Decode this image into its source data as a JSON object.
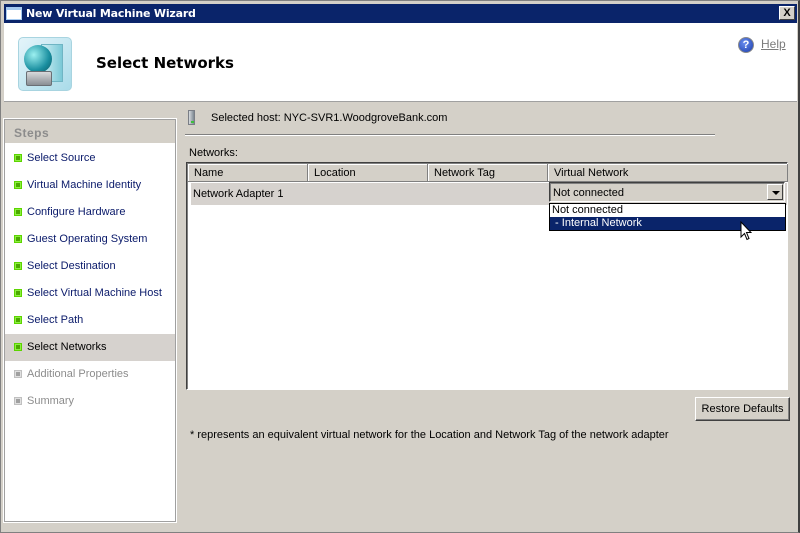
{
  "window": {
    "title": "New Virtual Machine Wizard",
    "close_label": "X"
  },
  "header": {
    "title": "Select Networks",
    "help_label": "Help",
    "help_icon": "?"
  },
  "steps": {
    "heading": "Steps",
    "items": [
      {
        "label": "Select Source",
        "state": "done"
      },
      {
        "label": "Virtual Machine Identity",
        "state": "done"
      },
      {
        "label": "Configure Hardware",
        "state": "done"
      },
      {
        "label": "Guest Operating System",
        "state": "done"
      },
      {
        "label": "Select Destination",
        "state": "done"
      },
      {
        "label": "Select Virtual Machine Host",
        "state": "done"
      },
      {
        "label": "Select Path",
        "state": "done"
      },
      {
        "label": "Select Networks",
        "state": "active"
      },
      {
        "label": "Additional Properties",
        "state": "pending"
      },
      {
        "label": "Summary",
        "state": "pending"
      }
    ]
  },
  "main": {
    "host_label": "Selected host: NYC-SVR1.WoodgroveBank.com",
    "networks_label": "Networks:",
    "columns": [
      "Name",
      "Location",
      "Network Tag",
      "Virtual Network"
    ],
    "rows": [
      {
        "name": "Network Adapter 1",
        "location": "",
        "network_tag": "",
        "virtual_network": "Not connected"
      }
    ],
    "dropdown": {
      "selected_value": "Not connected",
      "options": [
        "Not connected",
        " - Internal Network"
      ],
      "highlighted_index": 1
    },
    "restore_button": "Restore Defaults",
    "footnote": "* represents an equivalent virtual network for the Location and Network Tag of the network adapter"
  }
}
